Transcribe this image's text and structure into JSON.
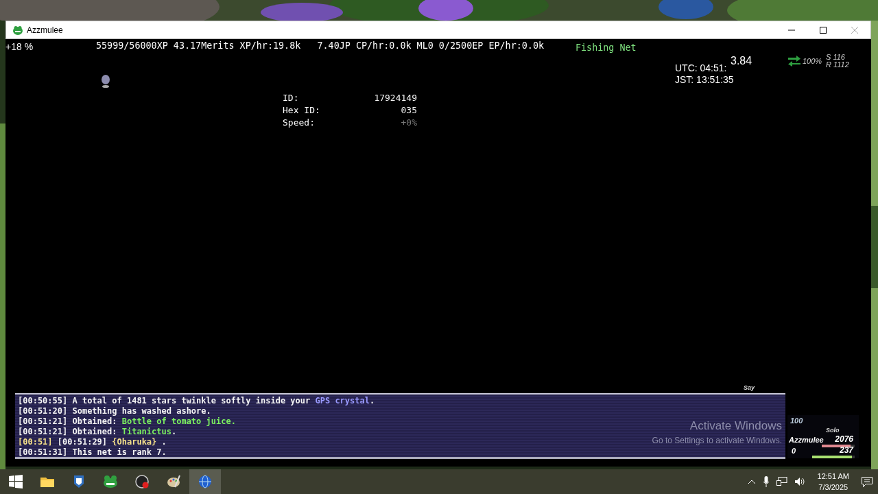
{
  "window": {
    "title": "Azzmulee"
  },
  "hud": {
    "percent": "+18 %",
    "stats": "55999/56000XP 43.17Merits XP/hr:19.8k   7.40JP CP/hr:0.0k ML0 0/2500EP EP/hr:0.0k",
    "target": "Fishing Net",
    "fps": "3.84",
    "utc": "UTC: 04:51:",
    "jst": "JST: 13:51:35",
    "network": {
      "percent": "100%",
      "sent": "S 116",
      "received": "R 1112"
    }
  },
  "info": [
    {
      "label": "ID:",
      "value": "17924149",
      "dim": false
    },
    {
      "label": "Hex ID:",
      "value": "035",
      "dim": false
    },
    {
      "label": "Speed:",
      "value": "+0%",
      "dim": true
    }
  ],
  "chat": {
    "channel": "Say",
    "lines": [
      {
        "parts": [
          {
            "kind": "plain",
            "text": "[00:50:55] A total of 1481 stars twinkle softly inside your "
          },
          {
            "kind": "key",
            "text": "GPS crystal"
          },
          {
            "kind": "plain",
            "text": "."
          }
        ]
      },
      {
        "parts": [
          {
            "kind": "plain",
            "text": "[00:51:20] Something has washed ashore."
          }
        ]
      },
      {
        "parts": [
          {
            "kind": "plain",
            "text": "[00:51:21] Obtained: "
          },
          {
            "kind": "item",
            "text": "Bottle of tomato juice."
          }
        ]
      },
      {
        "parts": [
          {
            "kind": "plain",
            "text": "[00:51:21] Obtained: "
          },
          {
            "kind": "item",
            "text": "Titanictus"
          },
          {
            "kind": "plain",
            "text": "."
          }
        ]
      },
      {
        "parts": [
          {
            "kind": "name",
            "text": "[00:51]"
          },
          {
            "kind": "plain",
            "text": " [00:51:29] "
          },
          {
            "kind": "name",
            "text": "{Oharuka}"
          },
          {
            "kind": "plain",
            "text": " ."
          }
        ]
      },
      {
        "parts": [
          {
            "kind": "plain",
            "text": "[00:51:31] This net is rank 7."
          }
        ]
      }
    ]
  },
  "notice": {
    "title": "Activate Windows",
    "hint": "Go to Settings to activate Windows."
  },
  "party": {
    "extra": "100",
    "mode": "Solo",
    "name": "Azzmulee",
    "tp": "0",
    "bars": [
      {
        "kind": "hp",
        "reading": "2076",
        "level": 0.88
      },
      {
        "kind": "mp",
        "reading": "237",
        "level": 0.93
      }
    ]
  },
  "taskbar": {
    "items": [
      {
        "kind": "start",
        "selected": false
      },
      {
        "kind": "folder",
        "selected": false
      },
      {
        "kind": "lion",
        "selected": false
      },
      {
        "kind": "frog",
        "selected": false
      },
      {
        "kind": "record",
        "selected": false
      },
      {
        "kind": "palette",
        "selected": false
      },
      {
        "kind": "globe",
        "selected": true
      }
    ],
    "time": "12:51 AM",
    "date": "7/3/2025"
  }
}
